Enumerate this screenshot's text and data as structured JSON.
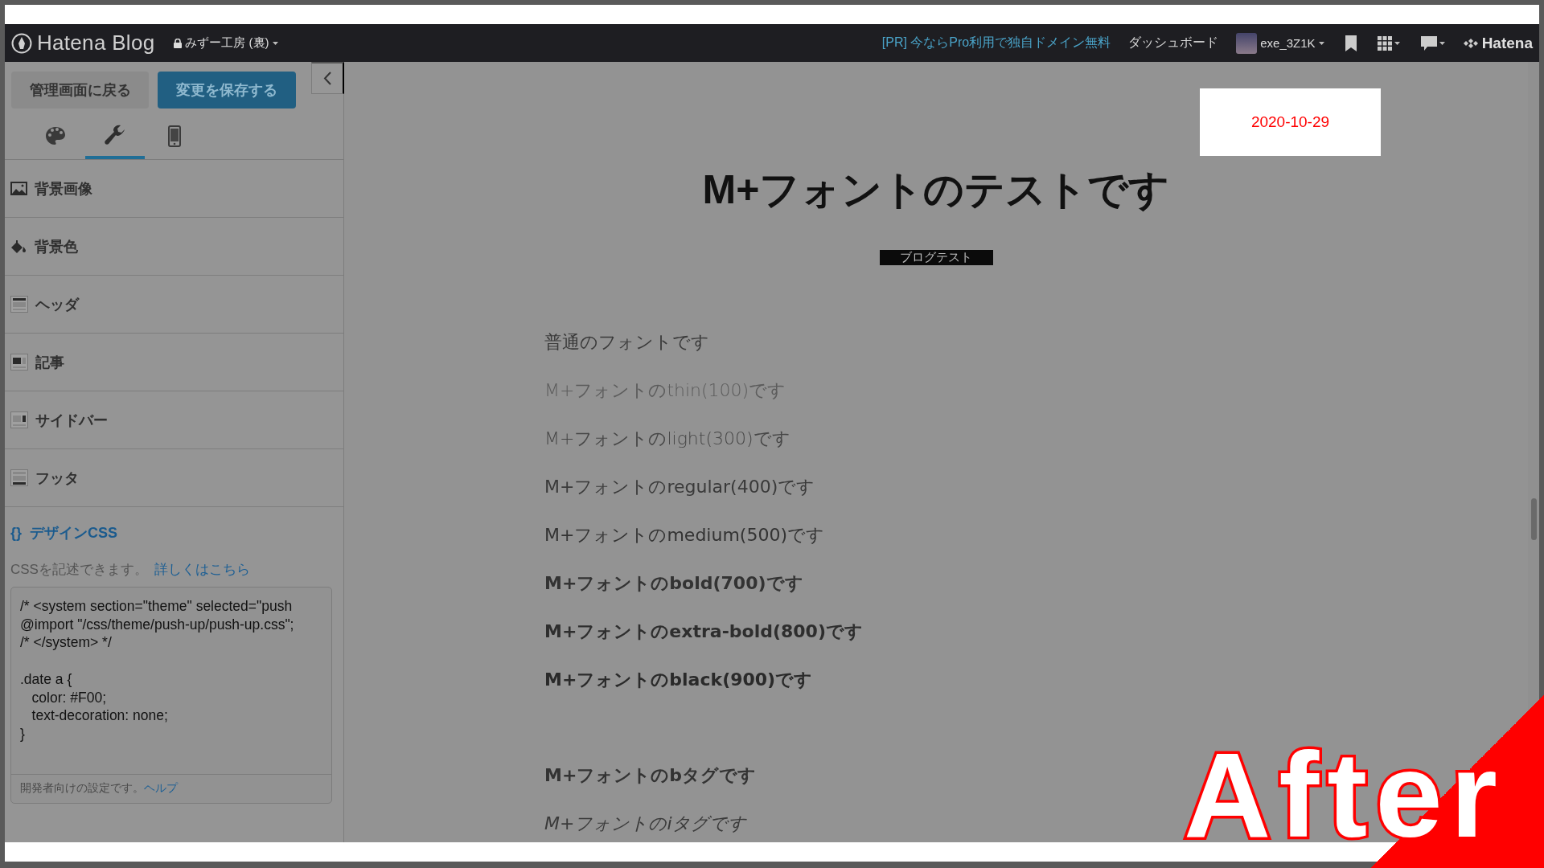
{
  "top_bar": {
    "logo": "Hatena Blog",
    "blog_name": "みずー工房 (裏)",
    "pr_link": "[PR] 今ならPro利用で独自ドメイン無料",
    "dashboard": "ダッシュボード",
    "user": "exe_3Z1K",
    "brand": "Hatena"
  },
  "sidebar": {
    "back_button": "管理画面に戻る",
    "save_button": "変更を保存する",
    "tabs": [
      {
        "kind": "palette",
        "selected": false
      },
      {
        "kind": "wrench",
        "selected": true
      },
      {
        "kind": "phone",
        "selected": false
      }
    ],
    "items": [
      {
        "kind": "image",
        "label": "背景画像"
      },
      {
        "kind": "bucket",
        "label": "背景色"
      },
      {
        "kind": "header",
        "label": "ヘッダ"
      },
      {
        "kind": "article",
        "label": "記事"
      },
      {
        "kind": "sidebar",
        "label": "サイドバー"
      },
      {
        "kind": "footer",
        "label": "フッタ"
      }
    ],
    "design_css": {
      "icon": "{}",
      "title": "デザインCSS",
      "description": "CSSを記述できます。",
      "link": "詳しくはこちら",
      "code": "/* <system section=\"theme\" selected=\"push\n@import \"/css/theme/push-up/push-up.css\";\n/* </system> */\n\n.date a {\n   color: #F00;\n   text-decoration: none;\n}",
      "hint": "開発者向けの設定です。",
      "hint_link": "ヘルプ"
    }
  },
  "article": {
    "date": "2020-10-29",
    "title": "M+フォントのテストです",
    "category": "ブログテスト",
    "paragraphs": [
      {
        "kind": "normal",
        "text": "普通のフォントです"
      },
      {
        "kind": "thin",
        "text": "M+フォントのthin(100)です"
      },
      {
        "kind": "light",
        "text": "M+フォントのlight(300)です"
      },
      {
        "kind": "regular",
        "text": "M+フォントのregular(400)です"
      },
      {
        "kind": "medium",
        "text": "M+フォントのmedium(500)です"
      },
      {
        "kind": "bold",
        "text": "M+フォントのbold(700)です"
      },
      {
        "kind": "extrabold",
        "text": "M+フォントのextra-bold(800)です"
      },
      {
        "kind": "black",
        "text": "M+フォントのblack(900)です"
      }
    ],
    "tag_paragraphs": [
      {
        "kind": "bold",
        "text": "M+フォントのbタグです"
      },
      {
        "kind": "italic",
        "text": "M+フォントのiタグです"
      }
    ]
  },
  "badge": "After"
}
